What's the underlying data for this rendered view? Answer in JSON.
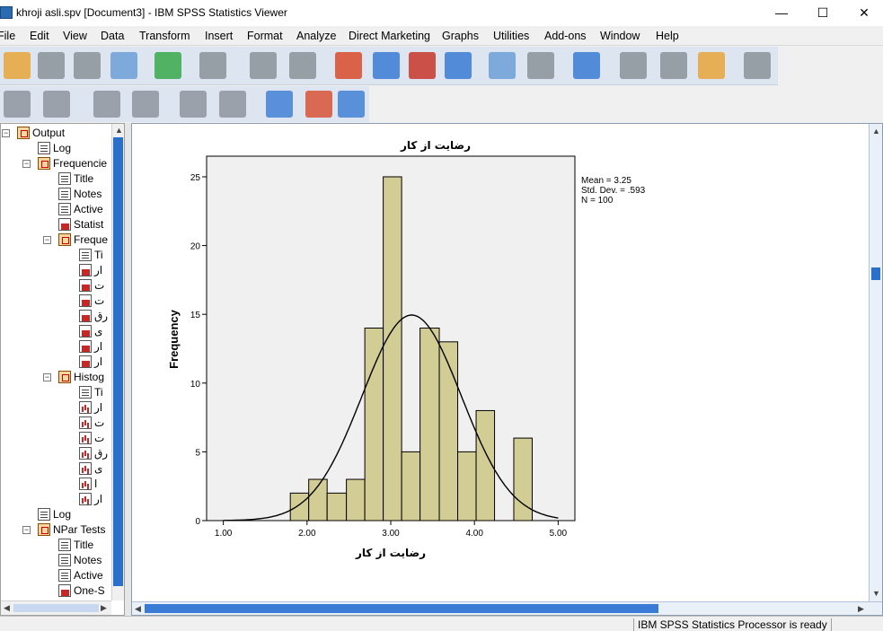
{
  "window": {
    "title": "khroji asli.spv [Document3] - IBM SPSS Statistics Viewer",
    "minimize": "—",
    "maximize": "☐",
    "close": "✕"
  },
  "menu": [
    "File",
    "Edit",
    "View",
    "Data",
    "Transform",
    "Insert",
    "Format",
    "Analyze",
    "Direct Marketing",
    "Graphs",
    "Utilities",
    "Add-ons",
    "Window",
    "Help"
  ],
  "toolbar1_icons": [
    "open-icon",
    "save-icon",
    "print-icon",
    "print-preview-icon",
    "export-icon",
    "recall-dialog-icon",
    "undo-icon",
    "redo-icon",
    "goto-data-icon",
    "goto-case-icon",
    "goto-variable-icon",
    "variables-icon",
    "use-variable-sets-icon",
    "show-all-variables-icon",
    "spelling-icon",
    "split-file-icon",
    "weight-cases-icon",
    "select-cases-icon",
    "value-labels-icon",
    "designate-window-icon"
  ],
  "toolbar2_icons": [
    "back-icon",
    "forward-icon",
    "expand-icon",
    "collapse-icon",
    "show-icon",
    "hide-icon",
    "insert-heading-icon",
    "insert-title-icon",
    "insert-text-icon"
  ],
  "tree": {
    "items": [
      {
        "label": "Output",
        "icon": "book-icon"
      },
      {
        "label": "Log",
        "icon": "log-icon"
      },
      {
        "label": "Frequencie",
        "icon": "book-icon"
      },
      {
        "label": "Title",
        "icon": "title-icon"
      },
      {
        "label": "Notes",
        "icon": "notes-icon"
      },
      {
        "label": "Active",
        "icon": "active-dataset-icon"
      },
      {
        "label": "Statist",
        "icon": "table-icon"
      },
      {
        "label": "Freque",
        "icon": "book-icon"
      },
      {
        "label": "Ti",
        "icon": "title-icon"
      },
      {
        "label": "ار",
        "icon": "table-icon"
      },
      {
        "label": "ت",
        "icon": "table-icon"
      },
      {
        "label": "ت",
        "icon": "table-icon"
      },
      {
        "label": "رق",
        "icon": "table-icon"
      },
      {
        "label": "ی",
        "icon": "table-icon"
      },
      {
        "label": "ار",
        "icon": "table-icon"
      },
      {
        "label": "ار",
        "icon": "table-icon"
      },
      {
        "label": "Histog",
        "icon": "book-icon"
      },
      {
        "label": "Ti",
        "icon": "title-icon"
      },
      {
        "label": "ار",
        "icon": "histogram-icon"
      },
      {
        "label": "ت",
        "icon": "histogram-icon"
      },
      {
        "label": "ت",
        "icon": "histogram-icon"
      },
      {
        "label": "رق",
        "icon": "histogram-icon"
      },
      {
        "label": "ی",
        "icon": "histogram-icon"
      },
      {
        "label": "ا",
        "icon": "histogram-icon"
      },
      {
        "label": "ار",
        "icon": "histogram-icon"
      },
      {
        "label": "Log",
        "icon": "log-icon"
      },
      {
        "label": "NPar Tests",
        "icon": "book-icon"
      },
      {
        "label": "Title",
        "icon": "title-icon"
      },
      {
        "label": "Notes",
        "icon": "notes-icon"
      },
      {
        "label": "Active",
        "icon": "active-dataset-icon"
      },
      {
        "label": "One-S",
        "icon": "table-icon"
      }
    ]
  },
  "status": {
    "processor": "IBM SPSS Statistics Processor is ready"
  },
  "chart_data": {
    "type": "bar",
    "title": "رضایت از کار",
    "xlabel": "رضایت از کار",
    "ylabel": "Frequency",
    "bin_edges": [
      1.8,
      2.02,
      2.24,
      2.47,
      2.69,
      2.91,
      3.13,
      3.35,
      3.58,
      3.8,
      4.02,
      4.24,
      4.47,
      4.69
    ],
    "values": [
      2,
      3,
      2,
      3,
      14,
      25,
      5,
      14,
      13,
      5,
      8,
      0,
      6
    ],
    "xlim": [
      0.8,
      5.2
    ],
    "ylim": [
      0,
      26.5
    ],
    "xticks": [
      1.0,
      2.0,
      3.0,
      4.0,
      5.0
    ],
    "xtick_labels": [
      "1.00",
      "2.00",
      "3.00",
      "4.00",
      "5.00"
    ],
    "yticks": [
      0,
      5,
      10,
      15,
      20,
      25
    ],
    "ytick_labels": [
      "0",
      "5",
      "10",
      "15",
      "20",
      "25"
    ],
    "stats": {
      "mean": "Mean = 3.25",
      "std": "Std. Dev. = .593",
      "n": "N = 100"
    },
    "normal_curve": {
      "mean": 3.25,
      "std": 0.593,
      "n": 100,
      "bin_width": 0.2222
    },
    "bar_color": "#d2cc95",
    "plot_bg": "#f0f0f0"
  }
}
